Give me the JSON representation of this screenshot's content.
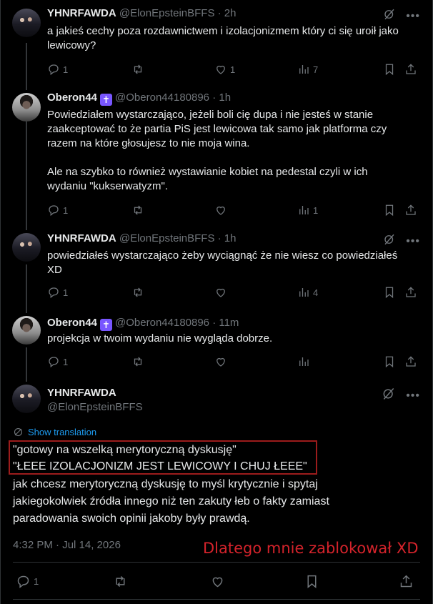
{
  "tweets": [
    {
      "name": "YHNRFAWDA",
      "handle": "@ElonEpsteinBFFS",
      "time": "· 2h",
      "verified": false,
      "text": "a jakieś cechy poza rozdawnictwem i izolacjonizmem który ci się uroił jako\nlewicowy?",
      "replies": "1",
      "reposts": "",
      "likes": "1",
      "views": "7"
    },
    {
      "name": "Oberon44",
      "handle": "@Oberon44180896",
      "time": "· 1h",
      "verified": true,
      "text": "Powiedziałem wystarczająco, jeżeli boli cię dupa i nie jesteś w stanie\nzaakceptować to że partia PiS jest lewicowa tak samo jak platforma czy\nrazem na które głosujesz to nie moja wina.\n\nAle na szybko to również wystawianie kobiet na pedestal czyli w ich\nwydaniu \"kukserwatyzm\".",
      "replies": "1",
      "reposts": "",
      "likes": "",
      "views": "1"
    },
    {
      "name": "YHNRFAWDA",
      "handle": "@ElonEpsteinBFFS",
      "time": "· 1h",
      "verified": false,
      "text": "powiedziałeś wystarczająco żeby wyciągnąć że nie wiesz co powiedziałeś\nXD",
      "replies": "1",
      "reposts": "",
      "likes": "",
      "views": "4"
    },
    {
      "name": "Oberon44",
      "handle": "@Oberon44180896",
      "time": "· 11m",
      "verified": true,
      "text": "projekcja w twoim wydaniu nie wygląda dobrze.",
      "replies": "1",
      "reposts": "",
      "likes": "",
      "views": ""
    }
  ],
  "main": {
    "name": "YHNRFAWDA",
    "handle": "@ElonEpsteinBFFS",
    "show_translation": "Show translation",
    "line1": "\"gotowy na wszelką merytoryczną dyskusję\"",
    "line2": "\"ŁEEE IZOLACJONIZM JEST LEWICOWY I CHUJ ŁEEE\"",
    "line3": "jak chcesz merytoryczną dyskusję to myśl krytycznie i spytaj",
    "line4": "jakiegokolwiek źródła innego niż ten zakuty łeb o fakty zamiast",
    "line5": "paradowania swoich opinii jakoby były prawdą.",
    "timestamp": "4:32 PM · Jul 14, 2026",
    "annotation": "Dlatego mnie zablokował XD",
    "replies": "1"
  },
  "badge_glyph": "✝",
  "colors": {
    "background": "#000000",
    "text": "#e7e9ea",
    "muted": "#71767b",
    "link": "#1d9bf0",
    "badge": "#7856ff",
    "annotation": "#d4232b",
    "highlight_border": "#9c1c1c"
  },
  "icons": [
    "grok-icon",
    "more-icon",
    "reply-icon",
    "repost-icon",
    "like-icon",
    "views-icon",
    "bookmark-icon",
    "share-icon",
    "translate-icon"
  ]
}
